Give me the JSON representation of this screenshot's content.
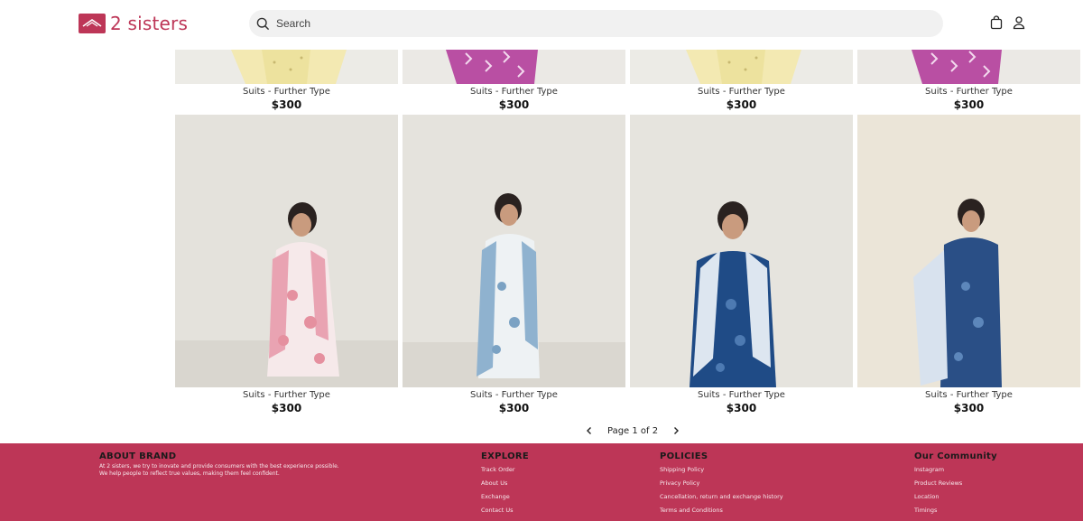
{
  "brand": {
    "name": "2 sisters",
    "color": "#bd3657"
  },
  "search": {
    "placeholder": "Search"
  },
  "header_icons": [
    "shopping-bag-icon",
    "user-icon"
  ],
  "products": [
    {
      "title": "Suits - Further Type",
      "price": "$300",
      "palette": "yellow"
    },
    {
      "title": "Suits - Further Type",
      "price": "$300",
      "palette": "magenta"
    },
    {
      "title": "Suits - Further Type",
      "price": "$300",
      "palette": "yellow"
    },
    {
      "title": "Suits - Further Type",
      "price": "$300",
      "palette": "magenta"
    },
    {
      "title": "Suits - Further Type",
      "price": "$300",
      "palette": "pink"
    },
    {
      "title": "Suits - Further Type",
      "price": "$300",
      "palette": "lightblue"
    },
    {
      "title": "Suits - Further Type",
      "price": "$300",
      "palette": "navy"
    },
    {
      "title": "Suits - Further Type",
      "price": "$300",
      "palette": "navy"
    }
  ],
  "pagination": {
    "text": "Page 1 of 2",
    "current": 1,
    "total": 2
  },
  "footer": {
    "about": {
      "heading": "ABOUT BRAND",
      "line1": "At 2 sisters, we try to inovate and provide consumers with the best experience possible.",
      "line2": "We help people to reflect true values, making them feel confident."
    },
    "explore": {
      "heading": "EXPLORE",
      "links": [
        "Track Order",
        "About Us",
        "Exchange",
        "Contact Us"
      ]
    },
    "policies": {
      "heading": "POLICIES",
      "links": [
        "Shipping Policy",
        "Privacy Policy",
        "Cancellation, return and exchange history",
        "Terms and Conditions"
      ]
    },
    "community": {
      "heading": "Our Community",
      "links": [
        "Instagram",
        "Product Reviews",
        "Location",
        "Timings"
      ]
    }
  }
}
